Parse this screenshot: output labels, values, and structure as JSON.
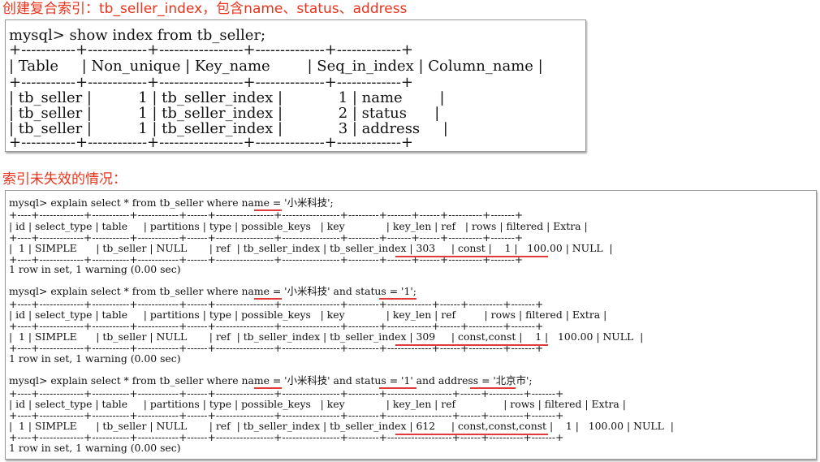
{
  "headings": {
    "create_index": "创建复合索引：tb_seller_index，包含name、status、address",
    "not_invalid": "索引未失效的情况："
  },
  "terminal1": {
    "lines": [
      "mysql> show index from tb_seller;",
      "+-----------+------------+-----------------+--------------+-------------+",
      "| Table     | Non_unique | Key_name        | Seq_in_index | Column_name |",
      "+-----------+------------+-----------------+--------------+-------------+",
      "| tb_seller |          1 | tb_seller_index |            1 | name        |",
      "| tb_seller |          1 | tb_seller_index |            2 | status      |",
      "| tb_seller |          1 | tb_seller_index |            3 | address     |",
      "+-----------+------------+-----------------+--------------+-------------+"
    ]
  },
  "terminal2": {
    "query1": {
      "command": "mysql> explain select * from tb_seller where name = '小米科技';",
      "border": "+----+-------------+-----------+------------+------+-----------------+-----------------+---------+-------+------+----------+-------+",
      "header": "| id | select_type | table     | partitions | type | possible_keys   | key             | key_len | ref   | rows | filtered | Extra |",
      "row": "|  1 | SIMPLE      | tb_seller | NULL       | ref  | tb_seller_index | tb_seller_index | 303     | const |    1 |   100.00 | NULL  |",
      "footer": "1 row in set, 1 warning (0.00 sec)"
    },
    "query2": {
      "command": "mysql> explain select * from tb_seller where name = '小米科技' and status = '1';",
      "border": "+----+-------------+-----------+------------+------+-----------------+-----------------+---------+-------------+------+----------+-------+",
      "header": "| id | select_type | table     | partitions | type | possible_keys   | key             | key_len | ref         | rows | filtered | Extra |",
      "row": "|  1 | SIMPLE      | tb_seller | NULL       | ref  | tb_seller_index | tb_seller_index | 309     | const,const |    1 |   100.00 | NULL  |",
      "footer": "1 row in set, 1 warning (0.00 sec)"
    },
    "query3": {
      "command": "mysql> explain select * from tb_seller where name = '小米科技' and status = '1' and address = '北京市';",
      "border": "+----+-------------+-----------+------------+------+-----------------+-----------------+---------+-------------------+------+----------+-------+",
      "header": "| id | select_type | table     | partitions | type | possible_keys   | key             | key_len | ref               | rows | filtered | Extra |",
      "row": "|  1 | SIMPLE      | tb_seller | NULL       | ref  | tb_seller_index | tb_seller_index | 612     | const,const,const |    1 |   100.00 | NULL  |",
      "footer": "1 row in set, 1 warning (0.00 sec)"
    }
  },
  "colors": {
    "heading": "#e8341c",
    "underline": "#e03a3a",
    "terminal_border": "#9a9a9a"
  }
}
